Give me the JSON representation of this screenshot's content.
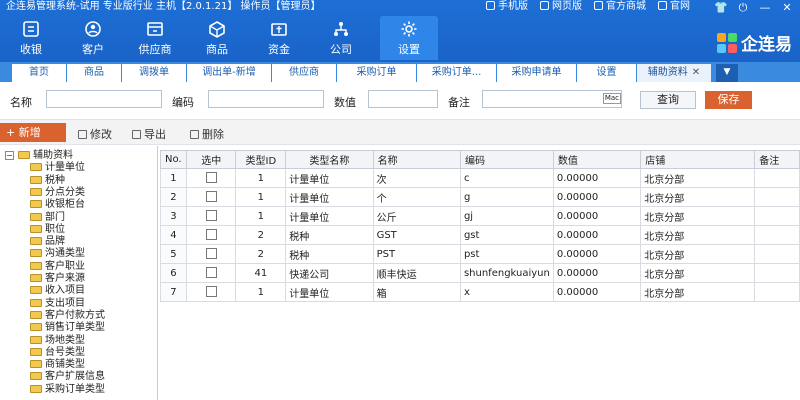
{
  "app": {
    "title": "企连易管理系统-试用 专业版行业 主机【2.0.1.21】 操作员【管理员】",
    "toplinks": [
      "手机版",
      "网页版",
      "官方商城",
      "官网"
    ],
    "logo_text": "企连易"
  },
  "nav": [
    {
      "label": "收银",
      "icon": "cashier-icon"
    },
    {
      "label": "客户",
      "icon": "customer-icon"
    },
    {
      "label": "供应商",
      "icon": "supplier-icon"
    },
    {
      "label": "商品",
      "icon": "goods-icon"
    },
    {
      "label": "资金",
      "icon": "money-icon"
    },
    {
      "label": "公司",
      "icon": "company-icon"
    },
    {
      "label": "设置",
      "icon": "gear-icon"
    }
  ],
  "tabs": [
    "首页",
    "商品",
    "调拨单",
    "调出单-新增",
    "供应商",
    "采购订单",
    "采购订单...",
    "采购申请单",
    "设置",
    "辅助资料"
  ],
  "search": {
    "name_label": "名称",
    "code_label": "编码",
    "value_label": "数值",
    "note_label": "备注",
    "mac_badge": "Mac",
    "query_btn": "查询",
    "save_btn": "保存"
  },
  "actions": {
    "add": "+ 新增",
    "edit": "修改",
    "export": "导出",
    "delete": "删除"
  },
  "tree": {
    "root": "辅助资料",
    "items": [
      "计量单位",
      "税种",
      "分点分类",
      "收银柜台",
      "部门",
      "职位",
      "品牌",
      "沟通类型",
      "客户职业",
      "客户来源",
      "收入项目",
      "支出项目",
      "客户付款方式",
      "销售订单类型",
      "场地类型",
      "台号类型",
      "商铺类型",
      "客户扩展信息",
      "采购订单类型"
    ]
  },
  "table": {
    "columns": [
      "No.",
      "选中",
      "类型ID",
      "类型名称",
      "名称",
      "编码",
      "数值",
      "店铺",
      "备注"
    ],
    "rows": [
      {
        "no": "1",
        "type_id": "1",
        "type_name": "计量单位",
        "name": "次",
        "code": "c",
        "value": "0.00000",
        "store": "北京分部"
      },
      {
        "no": "2",
        "type_id": "1",
        "type_name": "计量单位",
        "name": "个",
        "code": "g",
        "value": "0.00000",
        "store": "北京分部"
      },
      {
        "no": "3",
        "type_id": "1",
        "type_name": "计量单位",
        "name": "公斤",
        "code": "gj",
        "value": "0.00000",
        "store": "北京分部"
      },
      {
        "no": "4",
        "type_id": "2",
        "type_name": "税种",
        "name": "GST",
        "code": "gst",
        "value": "0.00000",
        "store": "北京分部"
      },
      {
        "no": "5",
        "type_id": "2",
        "type_name": "税种",
        "name": "PST",
        "code": "pst",
        "value": "0.00000",
        "store": "北京分部"
      },
      {
        "no": "6",
        "type_id": "41",
        "type_name": "快递公司",
        "name": "顺丰快运",
        "code": "shunfengkuaiyun",
        "value": "0.00000",
        "store": "北京分部"
      },
      {
        "no": "7",
        "type_id": "1",
        "type_name": "计量单位",
        "name": "箱",
        "code": "x",
        "value": "0.00000",
        "store": "北京分部"
      }
    ]
  },
  "colors": {
    "brand": "#1d6fd6",
    "accent": "#d9622e"
  }
}
